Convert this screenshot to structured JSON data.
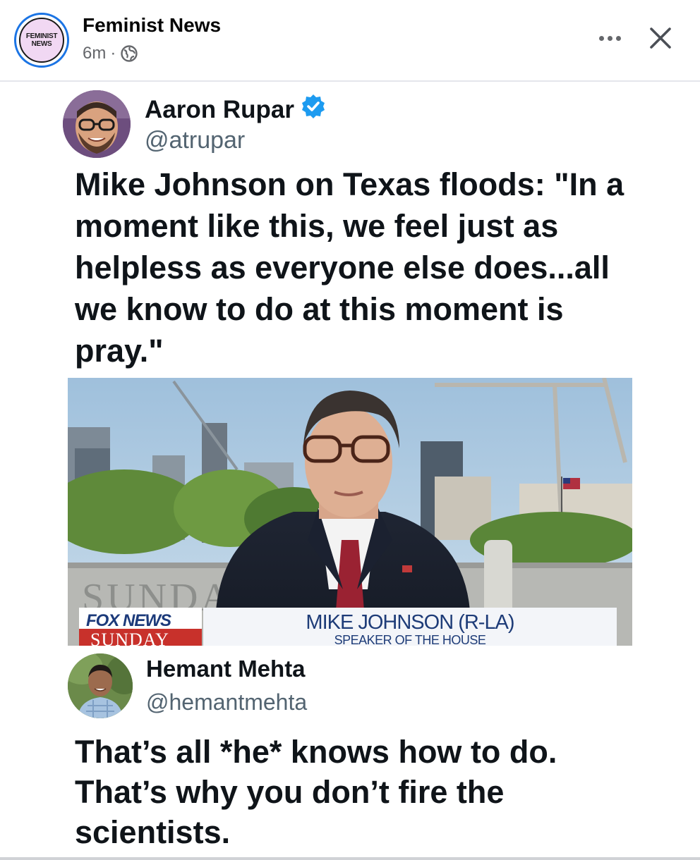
{
  "post": {
    "page_name": "Feminist News",
    "avatar_text_line1": "FEMINIST",
    "avatar_text_line2": "NEWS",
    "time_ago": "6m",
    "separator": "·",
    "audience_icon": "globe-icon",
    "more_icon": "more-options-icon",
    "close_icon": "close-icon",
    "accent_color": "#1b74e4"
  },
  "tweet1": {
    "author_name": "Aaron Rupar",
    "verified_icon": "verified-badge-icon",
    "verified_color": "#1d9bf0",
    "handle": "@atrupar",
    "text": "Mike Johnson on Texas floods: \"In a moment like this, we feel just as helpless as everyone else does...all we know to do at this moment is pray.\""
  },
  "tv_still": {
    "network_logo": "FOX NEWS",
    "show_name": "SUNDAY",
    "lower_third_name": "MIKE JOHNSON (R-LA)",
    "lower_third_title": "SPEAKER OF THE HOUSE",
    "backdrop_text": "SUNDAY"
  },
  "tweet2": {
    "author_name": "Hemant Mehta",
    "handle": "@hemantmehta",
    "text": "That’s all *he* knows how to do. That’s why you don’t fire the scientists."
  }
}
